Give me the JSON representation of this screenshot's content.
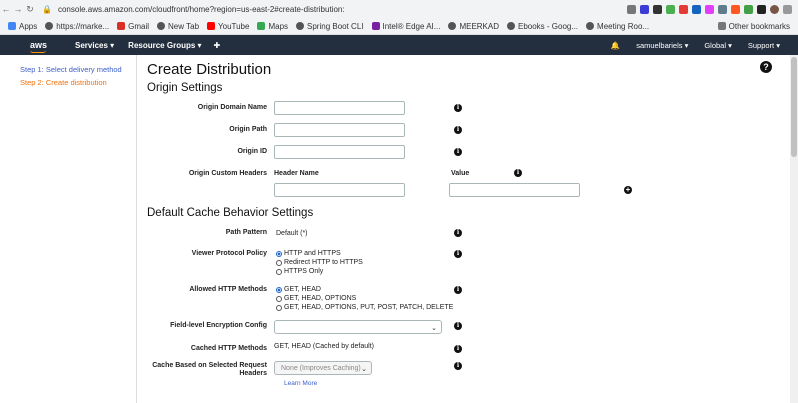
{
  "browser": {
    "url": "console.aws.amazon.com/cloudfront/home?region=us-east-2#create-distribution:",
    "bookmarks": [
      "Apps",
      "https://marke...",
      "Gmail",
      "New Tab",
      "YouTube",
      "Maps",
      "Spring Boot CLI",
      "Intel® Edge AI...",
      "MEERKAD",
      "Ebooks - Goog...",
      "Meeting Roo..."
    ],
    "other_bookmarks": "Other bookmarks"
  },
  "aws": {
    "logo": "aws",
    "services": "Services ▾",
    "resource_groups": "Resource Groups ▾",
    "user": "samuelbariels ▾",
    "region": "Global ▾",
    "support": "Support ▾"
  },
  "sidebar": {
    "step1": "Step 1: Select delivery method",
    "step2": "Step 2: Create distribution"
  },
  "page": {
    "title": "Create Distribution",
    "origin_settings": "Origin Settings",
    "cache_settings": "Default Cache Behavior Settings"
  },
  "origin": {
    "domain_name_label": "Origin Domain Name",
    "path_label": "Origin Path",
    "id_label": "Origin ID",
    "custom_headers_label": "Origin Custom Headers",
    "header_name_col": "Header Name",
    "value_col": "Value"
  },
  "cache": {
    "path_pattern_label": "Path Pattern",
    "path_pattern_value": "Default (*)",
    "viewer_protocol_label": "Viewer Protocol Policy",
    "viewer_protocol_options": [
      "HTTP and HTTPS",
      "Redirect HTTP to HTTPS",
      "HTTPS Only"
    ],
    "allowed_methods_label": "Allowed HTTP Methods",
    "allowed_methods_options": [
      "GET, HEAD",
      "GET, HEAD, OPTIONS",
      "GET, HEAD, OPTIONS, PUT, POST, PATCH, DELETE"
    ],
    "fle_label": "Field-level Encryption Config",
    "cached_methods_label": "Cached HTTP Methods",
    "cached_methods_value": "GET, HEAD (Cached by default)",
    "cache_headers_label_1": "Cache Based on Selected Request",
    "cache_headers_label_2": "Headers",
    "cache_headers_value": "None (Improves Caching)",
    "learn_more": "Learn More"
  }
}
